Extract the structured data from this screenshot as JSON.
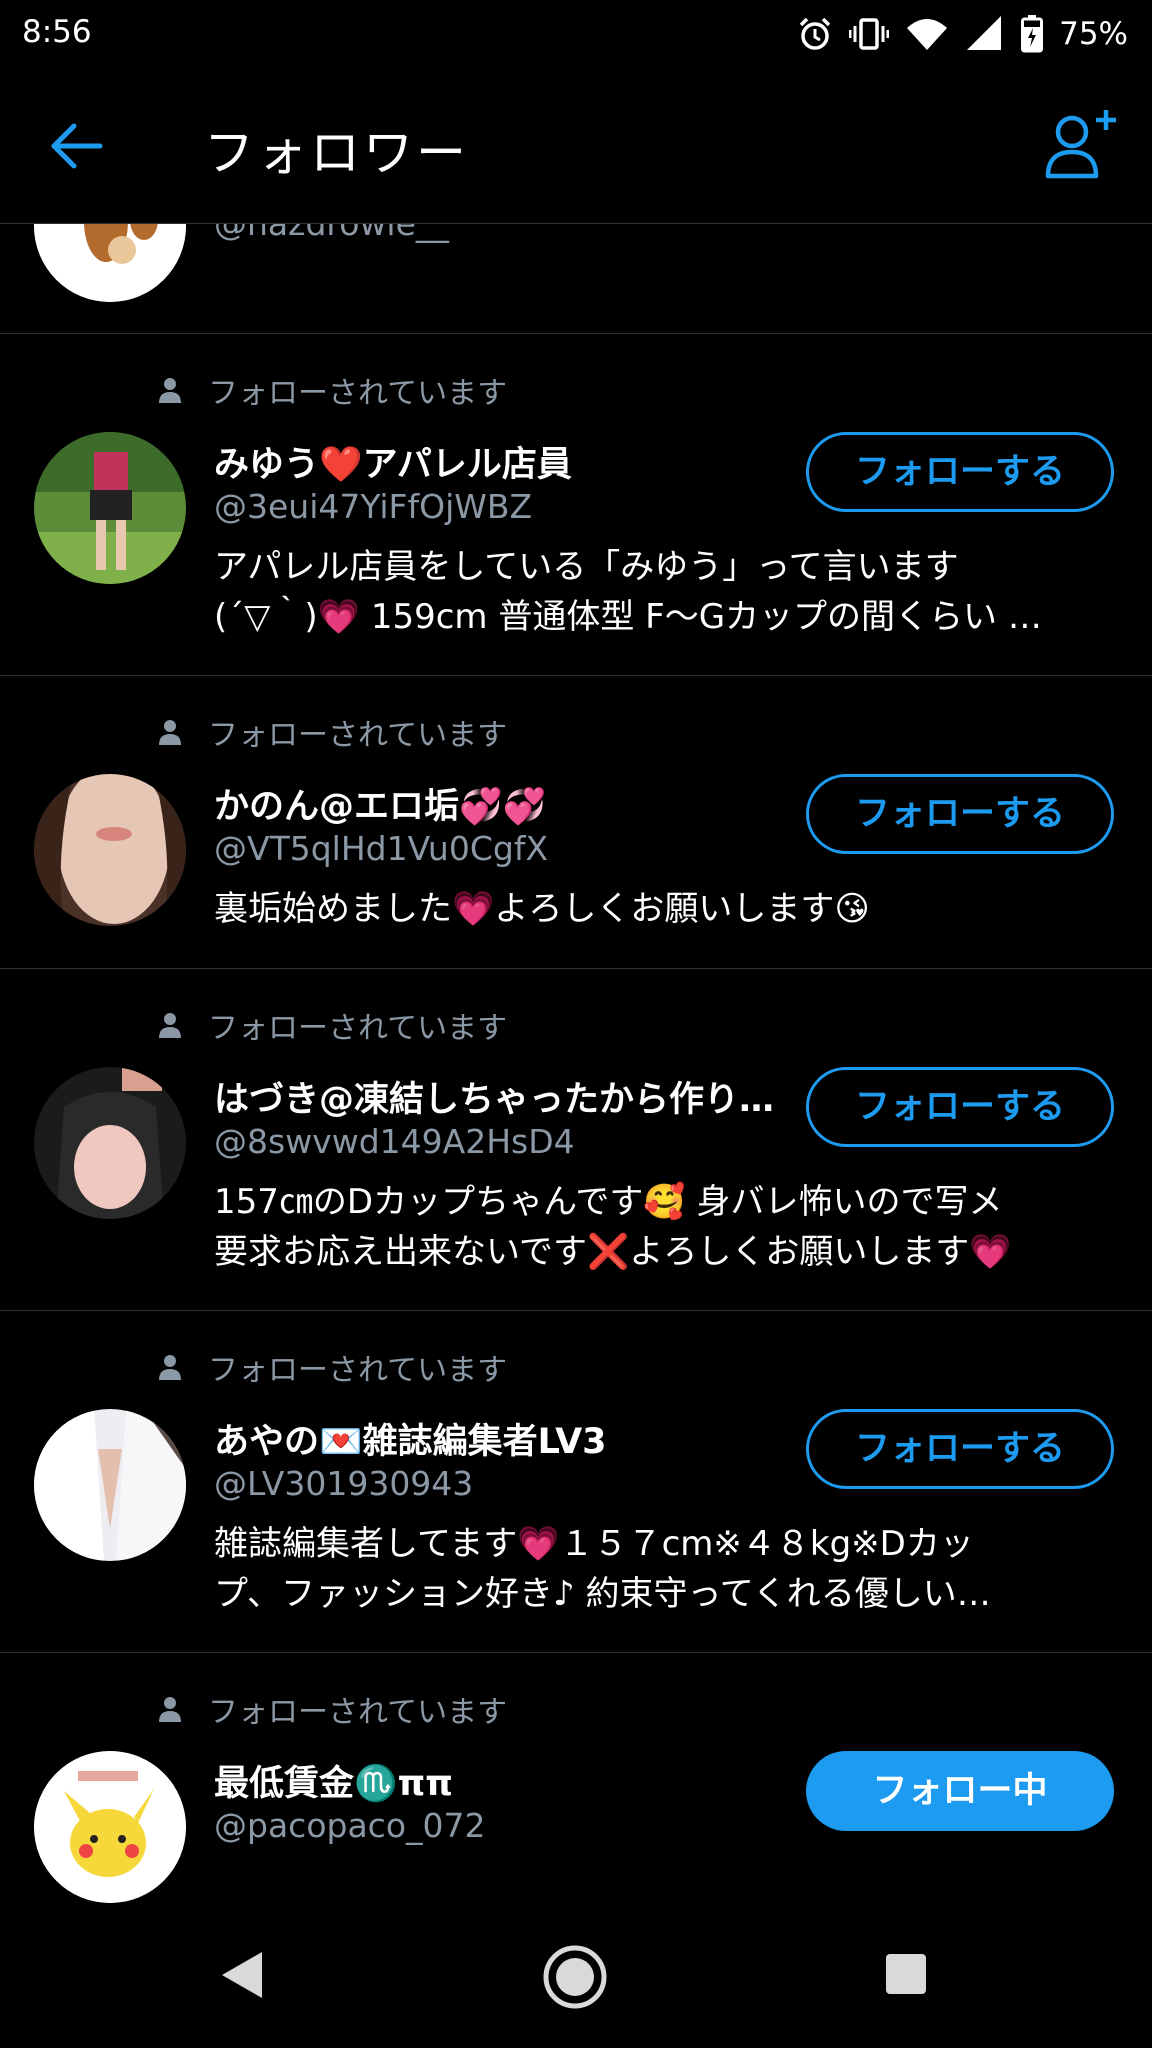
{
  "status_bar": {
    "time": "8:56",
    "battery": "75%"
  },
  "app_bar": {
    "title": "フォロワー"
  },
  "colors": {
    "accent": "#1d9bf0",
    "secondary_text": "#8b98a5",
    "divider": "#2f3336"
  },
  "partial_row": {
    "handle": "@nazdrowie__"
  },
  "followers": [
    {
      "follows_you": "フォローされています",
      "name": "みゆう❤️アパレル店員",
      "handle": "@3eui47YiFfOjWBZ",
      "bio": [
        "アパレル店員をしている「みゆう」って言います",
        "(´▽｀)💗 159cm 普通体型 F〜Gカップの間くらい …"
      ],
      "button": "フォローする"
    },
    {
      "follows_you": "フォローされています",
      "name": "かのん@エロ垢💞💞",
      "handle": "@VT5qlHd1Vu0CgfX",
      "bio": [
        "裏垢始めました💗よろしくお願いします😘"
      ],
      "button": "フォローする"
    },
    {
      "follows_you": "フォローされています",
      "name": "はづき@凍結しちゃったから作り…",
      "handle": "@8swvwd149A2HsD4",
      "bio": [
        "157㎝のDカップちゃんです🥰 身バレ怖いので写メ",
        "要求お応え出来ないです❌よろしくお願いします💗"
      ],
      "button": "フォローする"
    },
    {
      "follows_you": "フォローされています",
      "name": "あやの💌雑誌編集者LV3",
      "handle": "@LV301930943",
      "bio": [
        "雑誌編集者してます💗１５７cm※４８kg※Dカッ",
        "プ、ファッション好き♪ 約束守ってくれる優しい…"
      ],
      "button": "フォローする"
    },
    {
      "follows_you": "フォローされています",
      "name": "最低賃金♏️ππ",
      "handle": "@pacopaco_072",
      "bio": [],
      "button": "フォロー中"
    }
  ]
}
